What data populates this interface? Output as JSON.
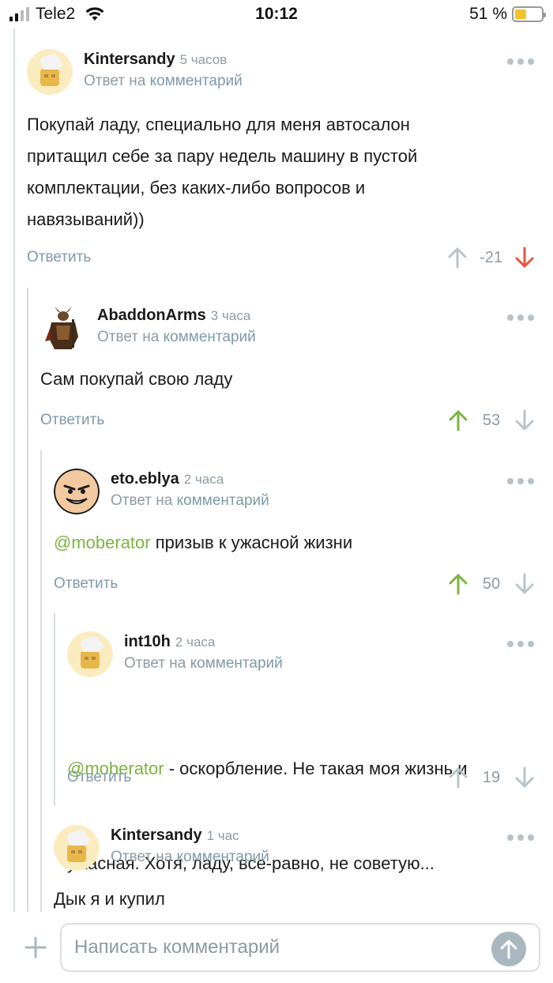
{
  "status_bar": {
    "carrier": "Tele2",
    "time": "10:12",
    "battery_percent": "51 %",
    "battery_level": 0.45
  },
  "comments": [
    {
      "author": "Kintersandy",
      "time": "5 часов",
      "reply_prefix": "Ответ на",
      "reply_link": "комментарий",
      "lines": [
        "Покупай ладу, специально для меня автосалон",
        "притащил себе за пару недель машину в пустой",
        "комплектации, без каких-либо вопросов и",
        "навязываний))"
      ],
      "reply_label": "Ответить",
      "score": "-21",
      "vote_state": "down"
    },
    {
      "author": "AbaddonArms",
      "time": "3 часа",
      "reply_prefix": "Ответ на",
      "reply_link": "комментарий",
      "lines": [
        "Сам покупай свою ладу"
      ],
      "reply_label": "Ответить",
      "score": "53",
      "vote_state": "up"
    },
    {
      "author": "eto.eblya",
      "time": "2 часа",
      "reply_prefix": "Ответ на",
      "reply_link": "комментарий",
      "mention": "@moberator",
      "lines": [
        " призыв к ужасной жизни"
      ],
      "reply_label": "Ответить",
      "score": "50",
      "vote_state": "up"
    },
    {
      "author": "int10h",
      "time": "2 часа",
      "reply_prefix": "Ответ на",
      "reply_link": "комментарий",
      "mention": "@moberator",
      "lines": [
        " - оскорбление. Не такая моя жизнь и",
        "ужасная. Хотя, ладу, все-равно, не советую..."
      ],
      "reply_label": "Ответить",
      "score": "19",
      "vote_state": "none"
    },
    {
      "author": "Kintersandy",
      "time": "1 час",
      "reply_prefix": "Ответ на",
      "reply_link": "комментарий",
      "lines": [
        "Дык я и купил"
      ]
    }
  ],
  "composer": {
    "placeholder": "Написать комментарий"
  },
  "colors": {
    "upvote_active": "#7cb342",
    "downvote_active": "#e8553b",
    "vote_inactive": "#b8c4cb",
    "mention": "#7cb342",
    "link": "#7f9aa8"
  }
}
